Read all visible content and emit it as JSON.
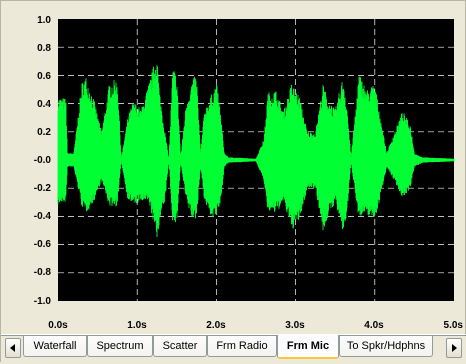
{
  "plot": {
    "background": "#000000",
    "waveform_color": "#00ff33",
    "grid_color": "#ffffff",
    "y_ticks": [
      "1.0",
      "0.8",
      "0.6",
      "0.4",
      "0.2",
      "-0.0",
      "-0.2",
      "-0.4",
      "-0.6",
      "-0.8",
      "-1.0"
    ],
    "x_ticks": [
      "0.0s",
      "1.0s",
      "2.0s",
      "3.0s",
      "4.0s",
      "5.0s"
    ]
  },
  "chart_data": {
    "type": "area",
    "title": "",
    "xlabel": "",
    "ylabel": "",
    "xlim": [
      0,
      5
    ],
    "ylim": [
      -1,
      1
    ],
    "grid": true,
    "series": [
      {
        "envelope_t": [
          0.0,
          0.1,
          0.12,
          0.2,
          0.3,
          0.35,
          0.45,
          0.55,
          0.65,
          0.75,
          0.8,
          0.88,
          0.95,
          1.05,
          1.15,
          1.25,
          1.28,
          1.35,
          1.4,
          1.45,
          1.5,
          1.55,
          1.62,
          1.7,
          1.75,
          1.8,
          1.85,
          1.95,
          2.0,
          2.05,
          2.1,
          2.15,
          2.5,
          2.6,
          2.65,
          2.75,
          2.85,
          2.95,
          3.05,
          3.15,
          3.25,
          3.35,
          3.4,
          3.5,
          3.6,
          3.65,
          3.7,
          3.8,
          3.9,
          4.0,
          4.05,
          4.15,
          4.25,
          4.35,
          4.45,
          4.5,
          4.6,
          5.0
        ],
        "envelope_upper": [
          0.45,
          0.44,
          0.05,
          0.05,
          0.55,
          0.6,
          0.44,
          0.2,
          0.55,
          0.58,
          0.01,
          0.3,
          0.42,
          0.36,
          0.55,
          0.76,
          0.5,
          0.2,
          0.01,
          0.67,
          0.6,
          0.02,
          0.42,
          0.58,
          0.6,
          0.05,
          0.36,
          0.48,
          0.56,
          0.35,
          0.05,
          0.02,
          0.01,
          0.15,
          0.48,
          0.5,
          0.35,
          0.55,
          0.45,
          0.2,
          0.2,
          0.55,
          0.44,
          0.36,
          0.6,
          0.38,
          0.02,
          0.62,
          0.5,
          0.55,
          0.38,
          0.05,
          0.2,
          0.35,
          0.25,
          0.05,
          0.02,
          0.01
        ],
        "envelope_lower": [
          -0.32,
          -0.3,
          -0.05,
          -0.05,
          -0.33,
          -0.38,
          -0.3,
          -0.15,
          -0.33,
          -0.33,
          -0.01,
          -0.28,
          -0.32,
          -0.3,
          -0.3,
          -0.57,
          -0.45,
          -0.3,
          -0.01,
          -0.47,
          -0.45,
          -0.02,
          -0.3,
          -0.43,
          -0.42,
          -0.05,
          -0.3,
          -0.42,
          -0.4,
          -0.33,
          -0.05,
          -0.02,
          -0.01,
          -0.15,
          -0.37,
          -0.38,
          -0.3,
          -0.5,
          -0.43,
          -0.2,
          -0.2,
          -0.52,
          -0.42,
          -0.3,
          -0.53,
          -0.38,
          -0.02,
          -0.42,
          -0.39,
          -0.42,
          -0.32,
          -0.05,
          -0.15,
          -0.27,
          -0.2,
          -0.05,
          -0.02,
          -0.01
        ]
      }
    ]
  },
  "tabs": {
    "scroll_left_icon": "triangle-left-icon",
    "scroll_right_icon": "triangle-right-icon",
    "items": [
      {
        "label": "Waterfall",
        "active": false
      },
      {
        "label": "Spectrum",
        "active": false
      },
      {
        "label": "Scatter",
        "active": false
      },
      {
        "label": "Frm Radio",
        "active": false
      },
      {
        "label": "Frm Mic",
        "active": true
      },
      {
        "label": "To Spkr/Hdphns",
        "active": false
      }
    ]
  }
}
